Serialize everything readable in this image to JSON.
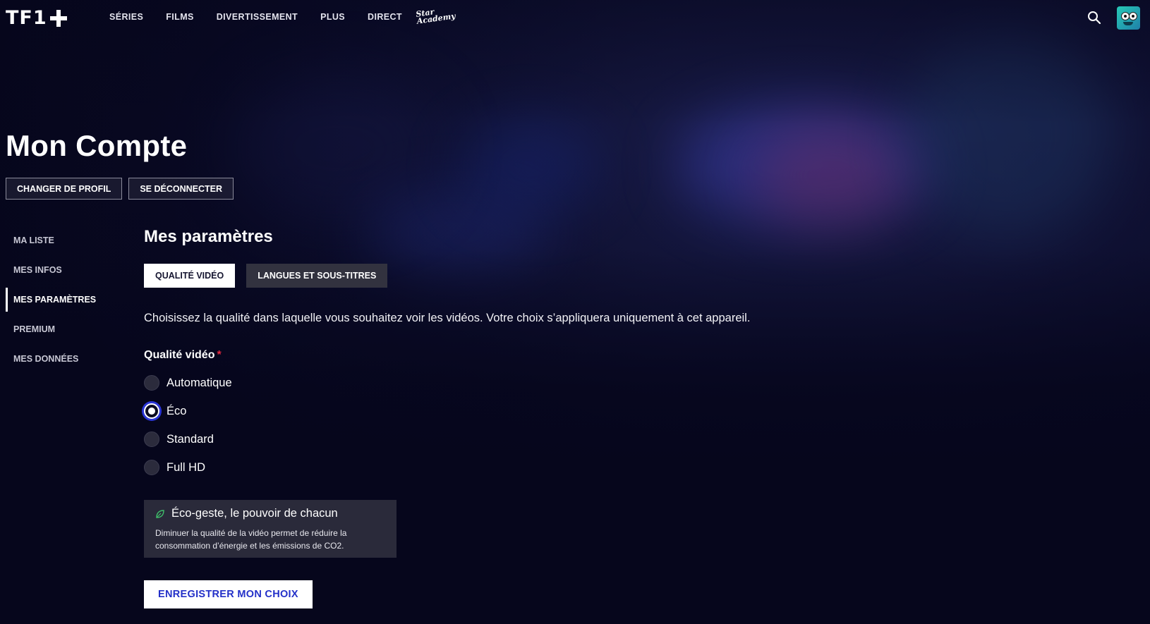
{
  "header": {
    "logo_text": "TF1",
    "nav": [
      "SÉRIES",
      "FILMS",
      "DIVERTISSEMENT",
      "PLUS",
      "DIRECT"
    ],
    "star_academy_logo": [
      "Star",
      "Academy"
    ],
    "search_icon": "search-icon",
    "avatar_icon": "profile-avatar"
  },
  "account": {
    "title": "Mon Compte",
    "change_profile": "CHANGER DE PROFIL",
    "logout": "SE DÉCONNECTER"
  },
  "sidebar": {
    "items": [
      {
        "label": "MA LISTE"
      },
      {
        "label": "MES INFOS"
      },
      {
        "label": "MES PARAMÈTRES",
        "active": true
      },
      {
        "label": "PREMIUM"
      },
      {
        "label": "MES DONNÉES"
      }
    ]
  },
  "settings": {
    "title": "Mes paramètres",
    "tabs": [
      {
        "label": "QUALITÉ VIDÉO",
        "active": true
      },
      {
        "label": "LANGUES ET SOUS-TITRES",
        "active": false
      }
    ],
    "description": "Choisissez la qualité dans laquelle vous souhaitez voir les vidéos. Votre choix s’appliquera uniquement à cet appareil.",
    "quality_label": "Qualité vidéo",
    "required_mark": "*",
    "options": [
      {
        "label": "Automatique",
        "checked": false
      },
      {
        "label": "Éco",
        "checked": true
      },
      {
        "label": "Standard",
        "checked": false
      },
      {
        "label": "Full HD",
        "checked": false
      }
    ],
    "eco_box": {
      "title": "Éco-geste, le pouvoir de chacun",
      "line1": "Diminuer la qualité de la vidéo permet de réduire la",
      "line2": "consommation d’énergie et les émissions de CO2."
    },
    "save_label": "ENREGISTRER MON CHOIX"
  },
  "colors": {
    "background": "#06061c",
    "accent_blue": "#2330c8",
    "required_red": "#e5273f",
    "leaf_green": "#3fbf6a"
  }
}
